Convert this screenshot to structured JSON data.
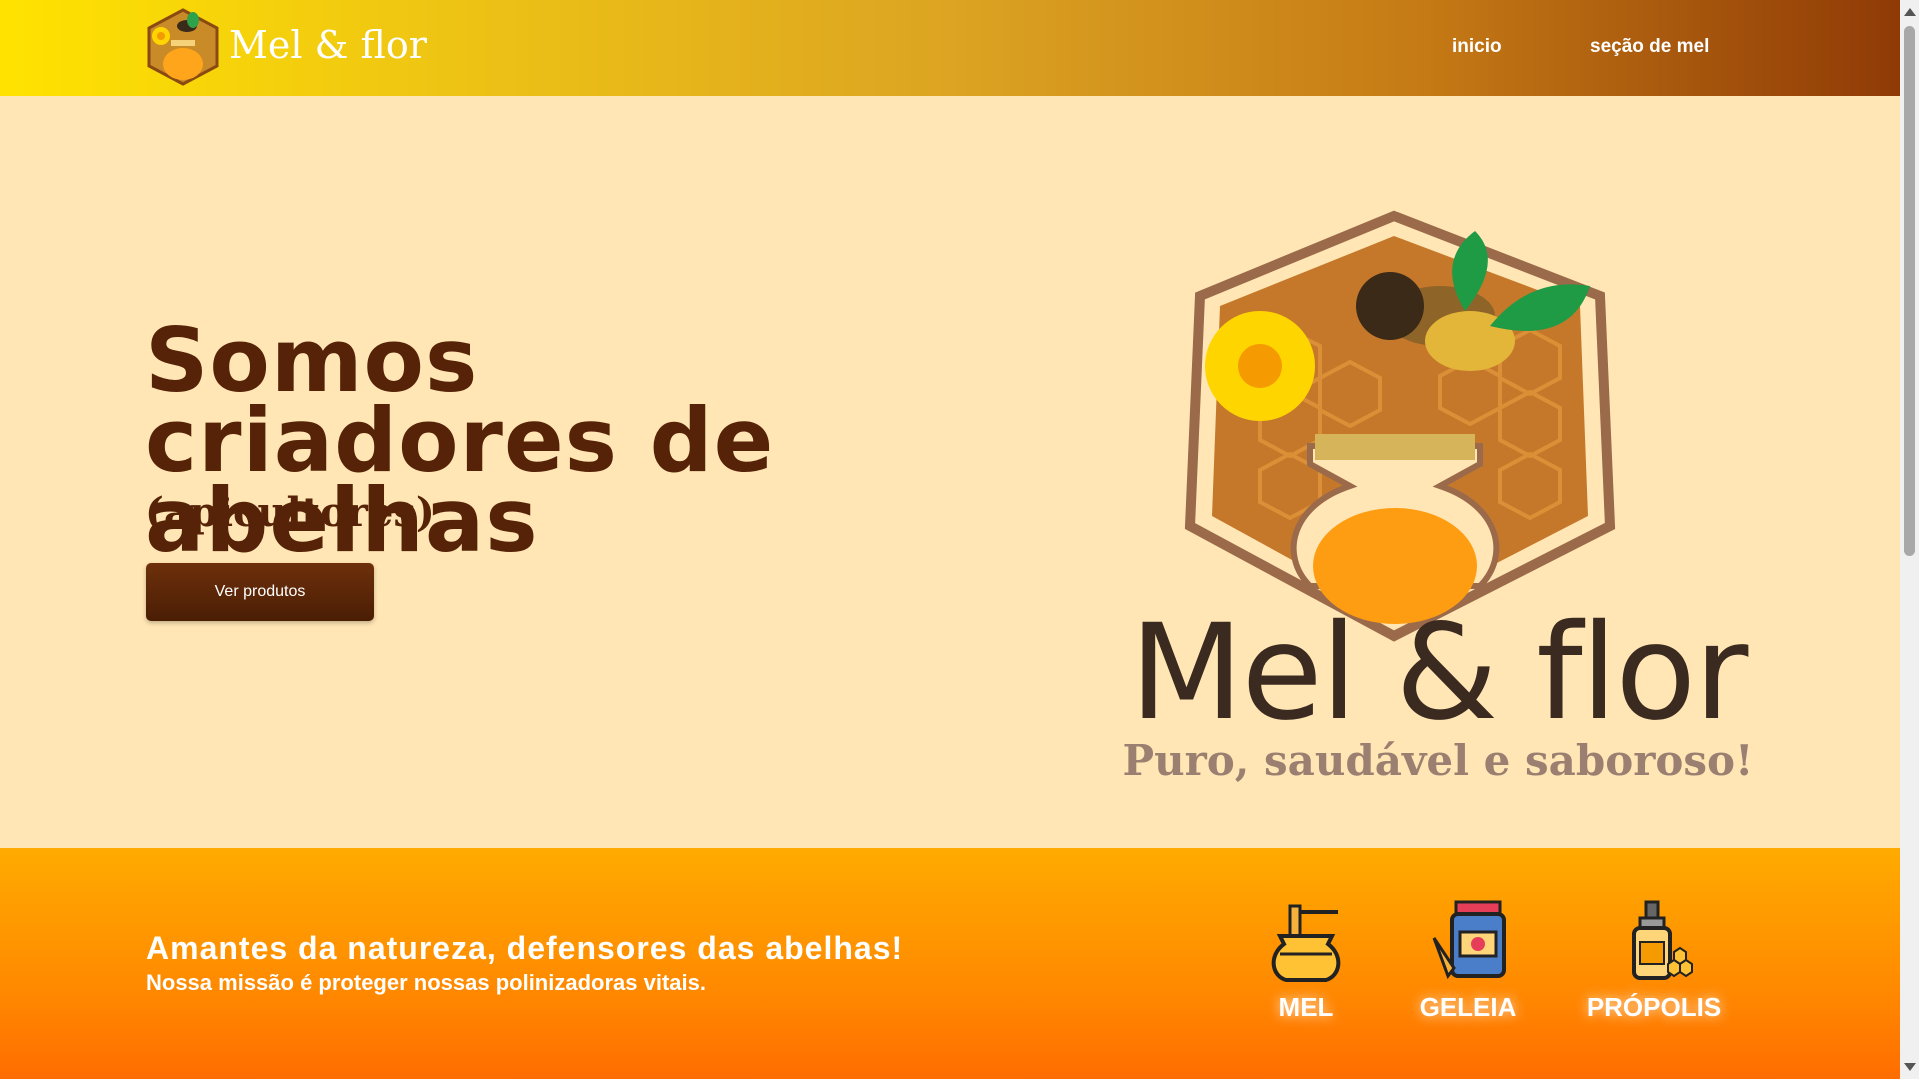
{
  "header": {
    "brand": "Mel & flor",
    "nav": [
      {
        "label": "inicio"
      },
      {
        "label": "seção de mel"
      }
    ]
  },
  "hero": {
    "title": "Somos criadores de abelhas",
    "subtitle": "(apicultores)",
    "button_label": "Ver produtos",
    "logo": {
      "brand": "Mel & flor",
      "tagline": "Puro, saudável e saboroso!"
    }
  },
  "band": {
    "title": "Amantes da natureza, defensores das abelhas!",
    "text": "Nossa missão é proteger nossas polinizadoras vitais.",
    "categories": [
      {
        "label": "MEL",
        "icon": "honey-pot-icon"
      },
      {
        "label": "GELEIA",
        "icon": "jam-jar-icon"
      },
      {
        "label": "PRÓPOLIS",
        "icon": "propolis-dropper-icon"
      }
    ]
  },
  "colors": {
    "header_start": "#ffe300",
    "header_end": "#8f3a06",
    "hero_bg": "#ffe6b4",
    "title_brown": "#562308",
    "band_orange": "#ff8a00"
  }
}
